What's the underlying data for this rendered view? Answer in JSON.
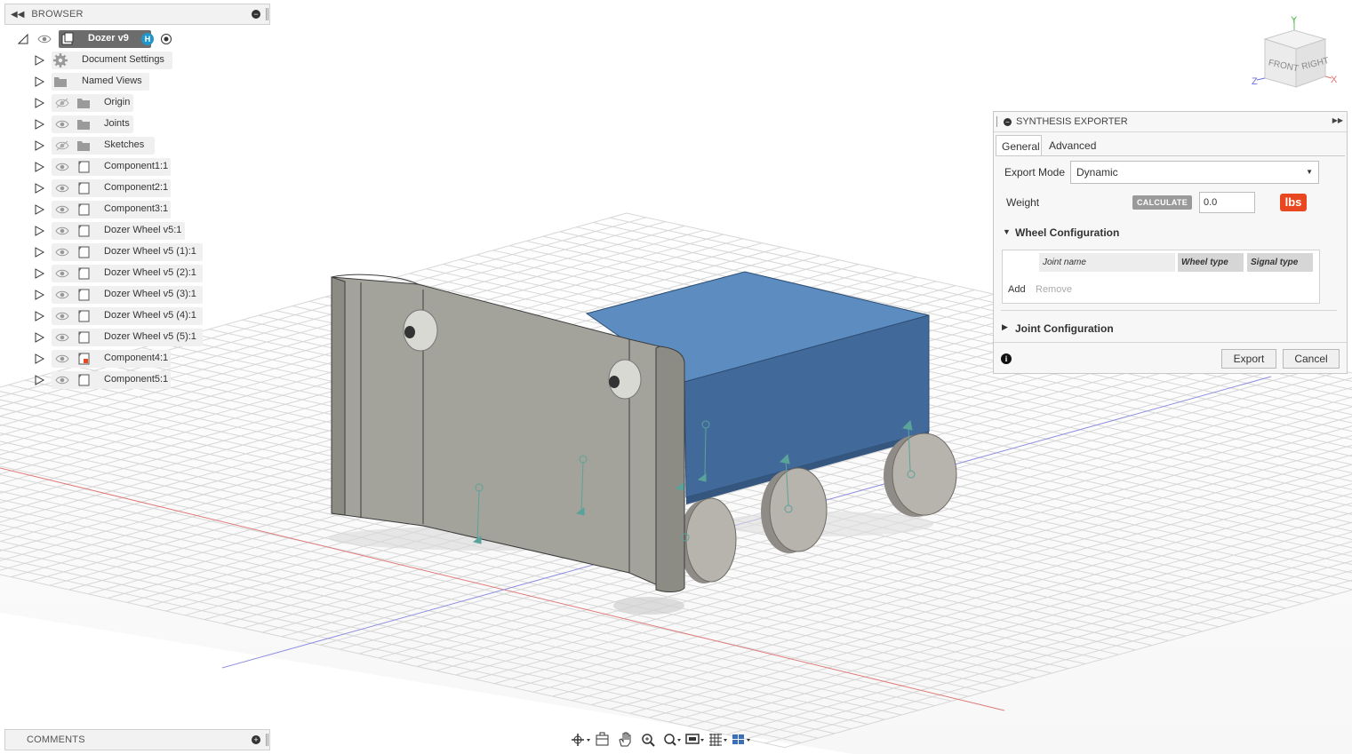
{
  "browser": {
    "header_label": "BROWSER",
    "root": {
      "label": "Dozer v9"
    },
    "items": [
      {
        "label": "Document Settings",
        "icon": "gear-icon",
        "visibility": "none"
      },
      {
        "label": "Named Views",
        "icon": "folder-icon",
        "visibility": "none"
      },
      {
        "label": "Origin",
        "icon": "folder-icon",
        "visibility": "hidden"
      },
      {
        "label": "Joints",
        "icon": "folder-icon",
        "visibility": "visible"
      },
      {
        "label": "Sketches",
        "icon": "folder-icon",
        "visibility": "hidden"
      },
      {
        "label": "Component1:1",
        "icon": "component-icon",
        "visibility": "visible"
      },
      {
        "label": "Component2:1",
        "icon": "component-icon",
        "visibility": "visible"
      },
      {
        "label": "Component3:1",
        "icon": "component-icon",
        "visibility": "visible"
      },
      {
        "label": "Dozer Wheel v5:1",
        "icon": "component-icon",
        "visibility": "visible"
      },
      {
        "label": "Dozer Wheel v5 (1):1",
        "icon": "component-icon",
        "visibility": "visible"
      },
      {
        "label": "Dozer Wheel v5 (2):1",
        "icon": "component-icon",
        "visibility": "visible"
      },
      {
        "label": "Dozer Wheel v5 (3):1",
        "icon": "component-icon",
        "visibility": "visible"
      },
      {
        "label": "Dozer Wheel v5 (4):1",
        "icon": "component-icon",
        "visibility": "visible"
      },
      {
        "label": "Dozer Wheel v5 (5):1",
        "icon": "component-icon",
        "visibility": "visible"
      },
      {
        "label": "Component4:1",
        "icon": "component-warning-icon",
        "visibility": "visible"
      },
      {
        "label": "Component5:1",
        "icon": "component-icon",
        "visibility": "visible"
      }
    ]
  },
  "viewcube": {
    "front": "FRONT",
    "right": "RIGHT",
    "axis_x": "X",
    "axis_y": "Y",
    "axis_z": "Z"
  },
  "exporter": {
    "title": "SYNTHESIS EXPORTER",
    "tabs": [
      "General",
      "Advanced"
    ],
    "export_mode_label": "Export Mode",
    "export_mode_value": "Dynamic",
    "weight_label": "Weight",
    "calculate_label": "CALCULATE",
    "weight_value": "0.0",
    "unit_label": "lbs",
    "wheel_section_title": "Wheel Configuration",
    "columns": [
      "Joint name",
      "Wheel type",
      "Signal type"
    ],
    "add_label": "Add",
    "remove_label": "Remove",
    "joint_section_title": "Joint Configuration",
    "export_label": "Export",
    "cancel_label": "Cancel"
  },
  "comments": {
    "header_label": "COMMENTS"
  },
  "colors": {
    "accent": "#e8471f",
    "body_blue": "#41699a",
    "plow_grey": "#a3a39b",
    "badge_blue": "#2196c9"
  }
}
